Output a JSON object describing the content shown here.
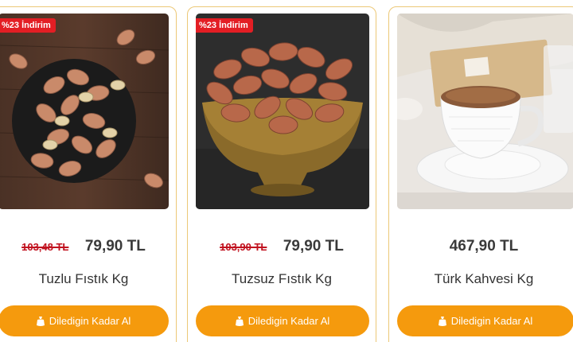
{
  "products": [
    {
      "badge": "%23 İndirim",
      "old_price": "103,48 TL",
      "price": "79,90 TL",
      "name": "Tuzlu Fıstık Kg",
      "button": "Diledigin Kadar Al",
      "image": "salted-peanuts-photo"
    },
    {
      "badge": "%23 İndirim",
      "old_price": "103,90 TL",
      "price": "79,90 TL",
      "name": "Tuzsuz Fıstık Kg",
      "button": "Diledigin Kadar Al",
      "image": "unsalted-peanuts-photo"
    },
    {
      "price": "467,90 TL",
      "name": "Türk Kahvesi Kg",
      "button": "Diledigin Kadar Al",
      "image": "turkish-coffee-photo"
    }
  ],
  "colors": {
    "accent": "#f59a0d",
    "badge": "#e31e24",
    "old_price": "#c1121f",
    "card_border": "#ecc877"
  }
}
